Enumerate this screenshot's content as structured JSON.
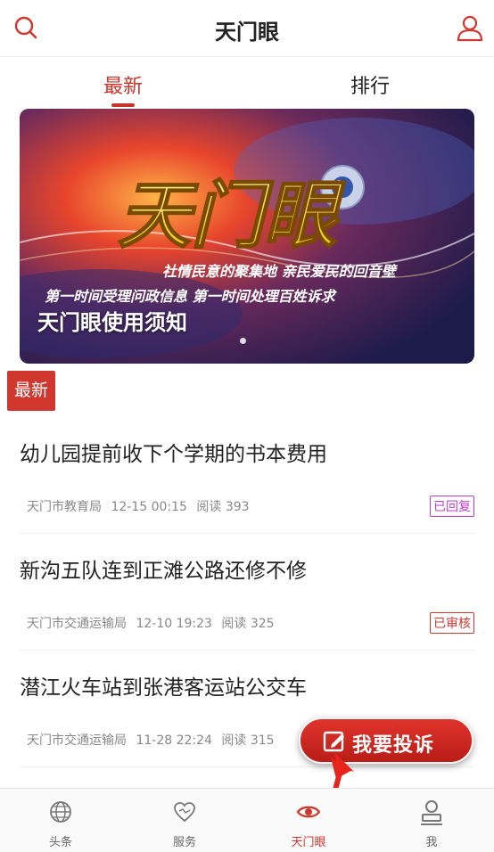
{
  "header": {
    "title": "天门眼"
  },
  "tabs": [
    {
      "label": "最新"
    },
    {
      "label": "排行"
    }
  ],
  "banner": {
    "logo_text": "天门眼",
    "slogan_line1": "社情民意的聚集地  亲民爱民的回音壁",
    "slogan_line2": "第一时间受理问政信息  第一时间处理百姓诉求",
    "caption": "天门眼使用须知"
  },
  "section_badge": "最新",
  "items": [
    {
      "title": "幼儿园提前收下个学期的书本费用",
      "dept": "天门市教育局",
      "time": "12-15 00:15",
      "reads": "阅读 393",
      "status": "已回复"
    },
    {
      "title": "新沟五队连到正滩公路还修不修",
      "dept": "天门市交通运输局",
      "time": "12-10 19:23",
      "reads": "阅读 325",
      "status": "已审核"
    },
    {
      "title": "潜江火车站到张港客运站公交车",
      "dept": "天门市交通运输局",
      "time": "11-28 22:24",
      "reads": "阅读 315",
      "status": ""
    }
  ],
  "complain_button": "我要投诉",
  "bottom_nav": [
    {
      "label": "头条",
      "icon": "globe-icon"
    },
    {
      "label": "服务",
      "icon": "heart-icon"
    },
    {
      "label": "天门眼",
      "icon": "eye-icon"
    },
    {
      "label": "我",
      "icon": "person-icon"
    }
  ],
  "colors": {
    "accent": "#d0372e",
    "replied": "#c03ccf"
  }
}
